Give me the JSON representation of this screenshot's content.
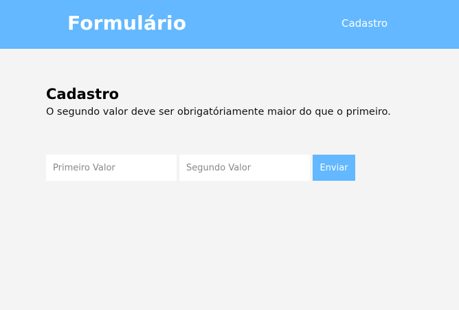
{
  "header": {
    "brand": "Formulário",
    "nav_link": "Cadastro"
  },
  "main": {
    "title": "Cadastro",
    "subtitle": "O segundo valor deve ser obrigatóriamente maior do que o primeiro."
  },
  "form": {
    "first_value": {
      "value": "",
      "placeholder": "Primeiro Valor"
    },
    "second_value": {
      "value": "",
      "placeholder": "Segundo Valor"
    },
    "submit_label": "Enviar"
  },
  "colors": {
    "accent": "#63b8ff",
    "background": "#f4f4f4",
    "header_text": "#ffffff"
  }
}
